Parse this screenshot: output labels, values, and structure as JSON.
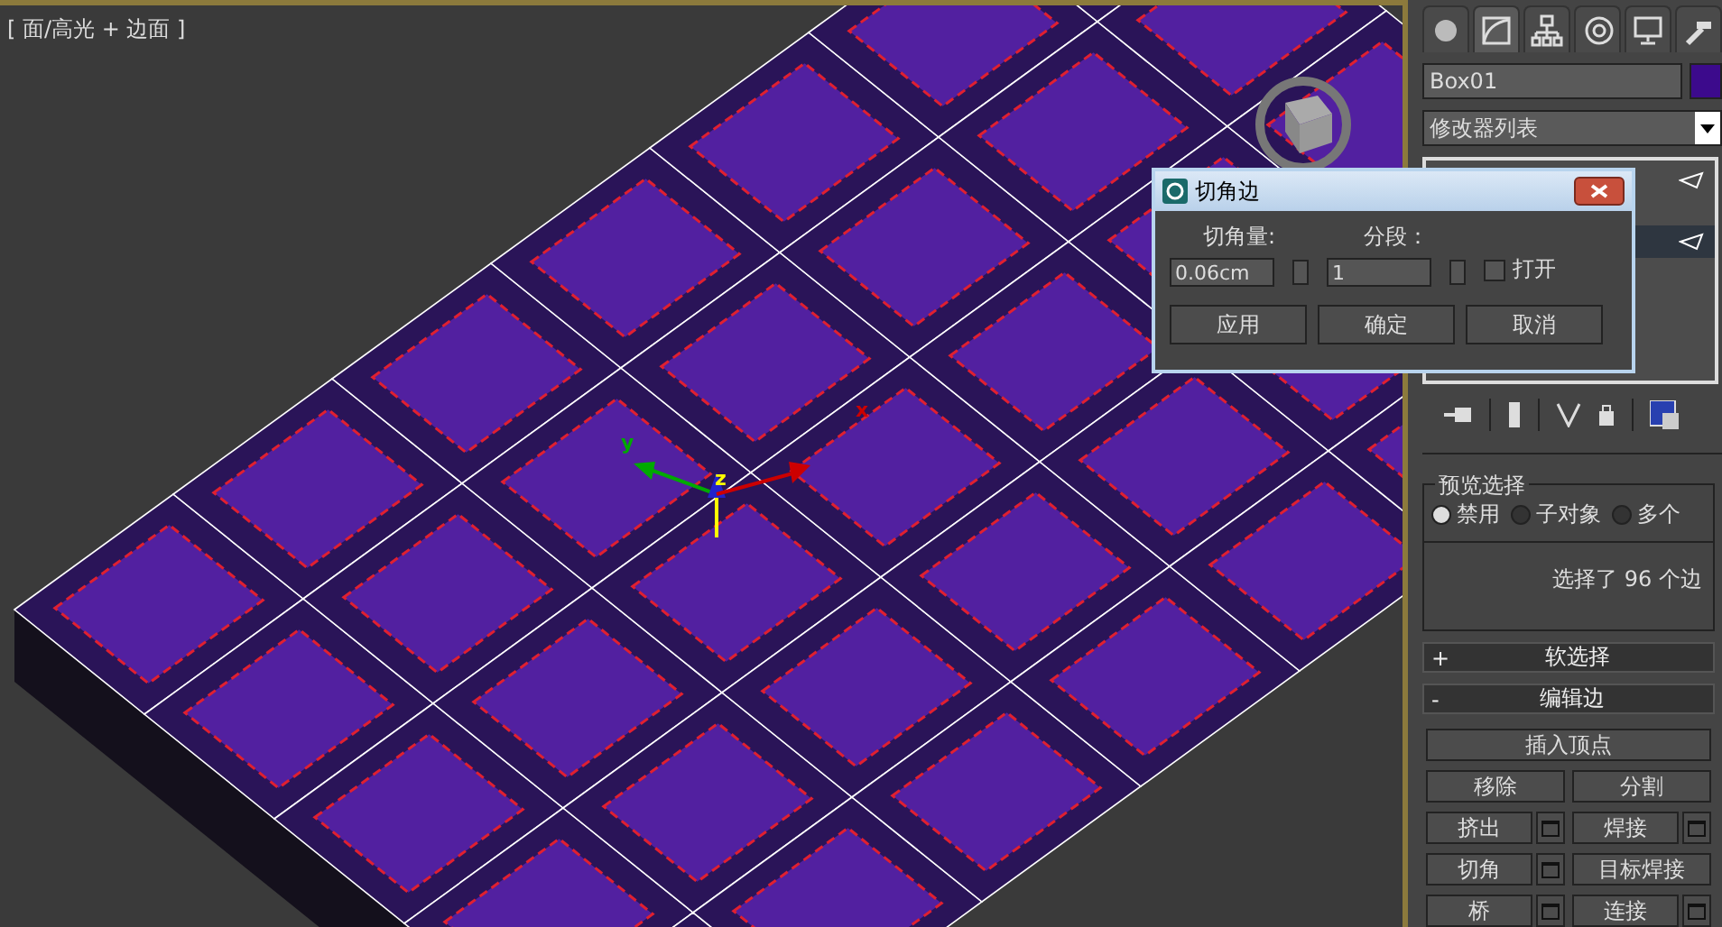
{
  "viewport": {
    "label": "[ 面/高光 + 边面 ]",
    "gizmo_labels": [
      "y",
      "z",
      "x"
    ]
  },
  "command_tabs": [
    {
      "kind": "create",
      "selected": false
    },
    {
      "kind": "modify",
      "selected": true
    },
    {
      "kind": "hierarchy",
      "selected": false
    },
    {
      "kind": "motion",
      "selected": false
    },
    {
      "kind": "display",
      "selected": false
    },
    {
      "kind": "utilities",
      "selected": false
    }
  ],
  "object": {
    "name": "Box01"
  },
  "modifier_list": {
    "value": "修改器列表"
  },
  "stack_rows": [
    {
      "selected": false
    },
    {
      "selected": true
    }
  ],
  "preview_selection": {
    "title": "预览选择",
    "options": [
      {
        "label": "禁用",
        "selected": true
      },
      {
        "label": "子对象",
        "selected": false
      },
      {
        "label": "多个",
        "selected": false
      }
    ]
  },
  "selection_info": "选择了 96 个边",
  "rollouts": [
    {
      "sign": "+",
      "title": "软选择"
    },
    {
      "sign": "-",
      "title": "编辑边"
    }
  ],
  "edit_buttons": [
    {
      "label": "插入顶点",
      "kind": "wide"
    },
    {
      "label": "移除",
      "kind": "plain"
    },
    {
      "label": "分割",
      "kind": "plain"
    },
    {
      "label": "挤出",
      "kind": "settings"
    },
    {
      "label": "焊接",
      "kind": "settings"
    },
    {
      "label": "切角",
      "kind": "settings"
    },
    {
      "label": "目标焊接",
      "kind": "plain"
    },
    {
      "label": "桥",
      "kind": "settings"
    },
    {
      "label": "连接",
      "kind": "settings"
    }
  ],
  "dialog": {
    "title": "切角边",
    "fields": [
      {
        "label": "切角量:",
        "value": "0.06cm"
      },
      {
        "label": "分段：",
        "value": "1"
      }
    ],
    "checkbox": {
      "label": "打开",
      "checked": false
    },
    "buttons": [
      "应用",
      "确定",
      "取消"
    ]
  }
}
